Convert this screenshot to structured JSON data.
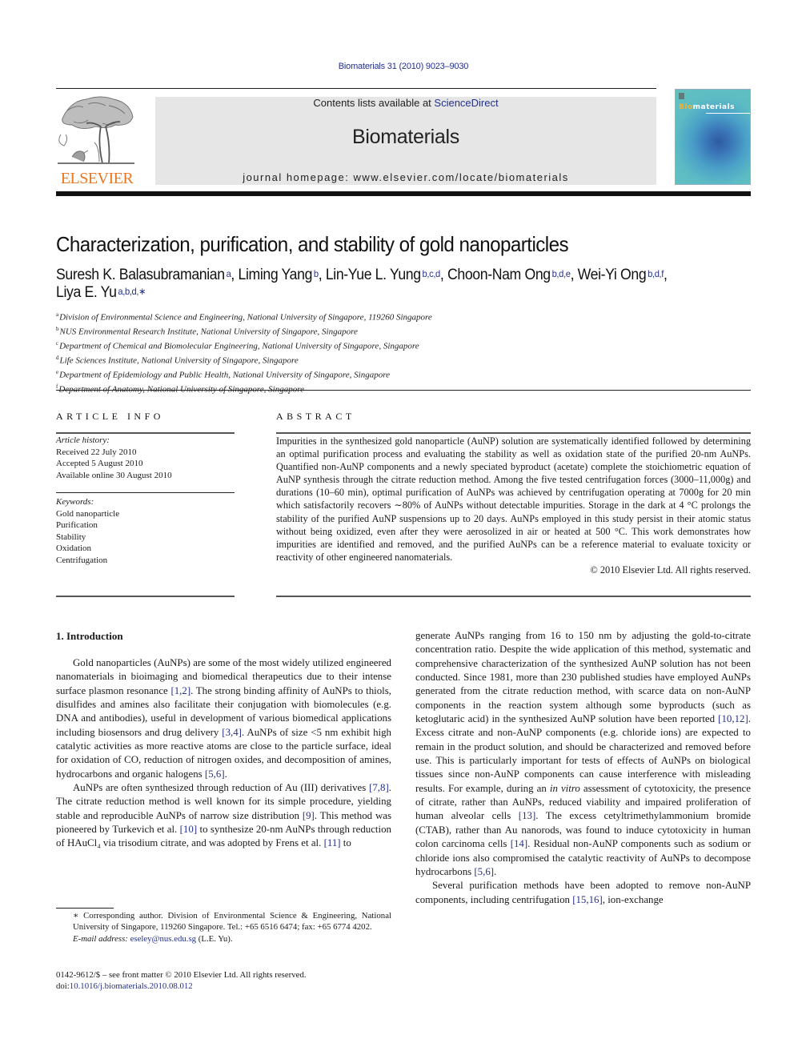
{
  "header": {
    "journal_ref": "Biomaterials 31 (2010) 9023–9030",
    "contents_prefix": "Contents lists available at ",
    "contents_link": "ScienceDirect",
    "journal_title": "Biomaterials",
    "homepage": "journal homepage: www.elsevier.com/locate/biomaterials",
    "publisher": "ELSEVIER",
    "cover_title_a": "Bio",
    "cover_title_b": "materials"
  },
  "article": {
    "title": "Characterization, purification, and stability of gold nanoparticles",
    "authors": [
      {
        "name": "Suresh K. Balasubramanian",
        "aff": "a",
        "sep": ", "
      },
      {
        "name": "Liming Yang",
        "aff": "b",
        "sep": ", "
      },
      {
        "name": "Lin-Yue L. Yung",
        "aff": "b,c,d",
        "sep": ", "
      },
      {
        "name": "Choon-Nam Ong",
        "aff": "b,d,e",
        "sep": ", "
      },
      {
        "name": "Wei-Yi Ong",
        "aff": "b,d,f",
        "sep": ","
      },
      {
        "name": "Liya E. Yu",
        "aff": "a,b,d,∗",
        "sep": ""
      }
    ],
    "affiliations": [
      {
        "mark": "a",
        "text": "Division of Environmental Science and Engineering, National University of Singapore, 119260 Singapore"
      },
      {
        "mark": "b",
        "text": "NUS Environmental Research Institute, National University of Singapore, Singapore"
      },
      {
        "mark": "c",
        "text": "Department of Chemical and Biomolecular Engineering, National University of Singapore, Singapore"
      },
      {
        "mark": "d",
        "text": "Life Sciences Institute, National University of Singapore, Singapore"
      },
      {
        "mark": "e",
        "text": "Department of Epidemiology and Public Health, National University of Singapore, Singapore"
      },
      {
        "mark": "f",
        "text": "Department of Anatomy, National University of Singapore, Singapore"
      }
    ]
  },
  "article_info": {
    "heading": "ARTICLE INFO",
    "history_label": "Article history:",
    "history": [
      "Received 22 July 2010",
      "Accepted 5 August 2010",
      "Available online 30 August 2010"
    ],
    "keywords_label": "Keywords:",
    "keywords": [
      "Gold nanoparticle",
      "Purification",
      "Stability",
      "Oxidation",
      "Centrifugation"
    ]
  },
  "abstract": {
    "heading": "ABSTRACT",
    "text": "Impurities in the synthesized gold nanoparticle (AuNP) solution are systematically identified followed by determining an optimal purification process and evaluating the stability as well as oxidation state of the purified 20-nm AuNPs. Quantified non-AuNP components and a newly speciated byproduct (acetate) complete the stoichiometric equation of AuNP synthesis through the citrate reduction method. Among the five tested centrifugation forces (3000–11,000g) and durations (10–60 min), optimal purification of AuNPs was achieved by centrifugation operating at 7000g for 20 min which satisfactorily recovers ∼80% of AuNPs without detectable impurities. Storage in the dark at 4 °C prolongs the stability of the purified AuNP suspensions up to 20 days. AuNPs employed in this study persist in their atomic status without being oxidized, even after they were aerosolized in air or heated at 500 °C. This work demonstrates how impurities are identified and removed, and the purified AuNPs can be a reference material to evaluate toxicity or reactivity of other engineered nanomaterials.",
    "copyright": "© 2010 Elsevier Ltd. All rights reserved."
  },
  "body": {
    "section_title": "1.  Introduction",
    "p1": [
      {
        "t": "Gold nanoparticles (AuNPs) are some of the most widely utilized engineered nanomaterials in bioimaging and biomedical therapeutics due to their intense surface plasmon resonance "
      },
      {
        "ref": "[1,2]"
      },
      {
        "t": ". The strong binding affinity of AuNPs to thiols, disulfides and amines also facilitate their conjugation with biomolecules (e.g. DNA and antibodies), useful in development of various biomedical applications including biosensors and drug delivery "
      },
      {
        "ref": "[3,4]"
      },
      {
        "t": ". AuNPs of size <5 nm exhibit high catalytic activities as more reactive atoms are close to the particle surface, ideal for oxidation of CO, reduction of nitrogen oxides, and decomposition of amines, hydrocarbons and organic halogens "
      },
      {
        "ref": "[5,6]"
      },
      {
        "t": "."
      }
    ],
    "p2": [
      {
        "t": "AuNPs are often synthesized through reduction of Au (III) derivatives "
      },
      {
        "ref": "[7,8]"
      },
      {
        "t": ". The citrate reduction method is well known for its simple procedure, yielding stable and reproducible AuNPs of narrow size distribution "
      },
      {
        "ref": "[9]"
      },
      {
        "t": ". This method was pioneered by Turkevich et al. "
      },
      {
        "ref": "[10]"
      },
      {
        "t": " to synthesize 20-nm AuNPs through reduction of HAuCl₄ via trisodium citrate, and was adopted by Frens et al. "
      },
      {
        "ref": "[11]"
      },
      {
        "t": " to"
      }
    ],
    "p3": [
      {
        "t": "generate AuNPs ranging from 16 to 150 nm by adjusting the gold-to-citrate concentration ratio. Despite the wide application of this method, systematic and comprehensive characterization of the synthesized AuNP solution has not been conducted. Since 1981, more than 230 published studies have employed AuNPs generated from the citrate reduction method, with scarce data on non-AuNP components in the reaction system although some byproducts (such as ketoglutaric acid) in the synthesized AuNP solution have been reported "
      },
      {
        "ref": "[10,12]"
      },
      {
        "t": ". Excess citrate and non-AuNP components (e.g. chloride ions) are expected to remain in the product solution, and should be characterized and removed before use. This is particularly important for tests of effects of AuNPs on biological tissues since non-AuNP components can cause interference with misleading results. For example, during an "
      },
      {
        "i": "in vitro"
      },
      {
        "t": " assessment of cytotoxicity, the presence of citrate, rather than AuNPs, reduced viability and impaired proliferation of human alveolar cells "
      },
      {
        "ref": "[13]"
      },
      {
        "t": ". The excess cetyltrimethylammonium bromide (CTAB), rather than Au nanorods, was found to induce cytotoxicity in human colon carcinoma cells "
      },
      {
        "ref": "[14]"
      },
      {
        "t": ". Residual non-AuNP components such as sodium or chloride ions also compromised the catalytic reactivity of AuNPs to decompose hydrocarbons "
      },
      {
        "ref": "[5,6]"
      },
      {
        "t": "."
      }
    ],
    "p4": [
      {
        "t": "Several purification methods have been adopted to remove non-AuNP components, including centrifugation "
      },
      {
        "ref": "[15,16]"
      },
      {
        "t": ", ion-exchange"
      }
    ]
  },
  "footnote": {
    "corresponding": "∗ Corresponding author. Division of Environmental Science & Engineering, National University of Singapore, 119260 Singapore. Tel.: +65 6516 6474; fax: +65 6774 4202.",
    "email_label": "E-mail address:",
    "email": "eseley@nus.edu.sg",
    "email_suffix": " (L.E. Yu)."
  },
  "front_matter": {
    "issn_line": "0142-9612/$ – see front matter © 2010 Elsevier Ltd. All rights reserved.",
    "doi_label": "doi:",
    "doi": "10.1016/j.biomaterials.2010.08.012"
  },
  "colors": {
    "link": "#25308a",
    "elsevier_orange": "#e87722",
    "masthead_bg": "#e6e6e6"
  }
}
